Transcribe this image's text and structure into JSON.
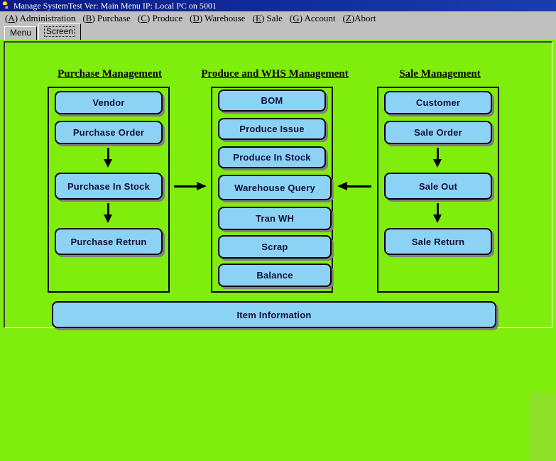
{
  "window": {
    "title": "Manage SystemTest Ver: Main Menu IP: Local PC on 5001",
    "icon": "app-icon"
  },
  "menubar": {
    "items": [
      {
        "accel": "A",
        "label": "Administration",
        "accel_prefix": "(A) ",
        "text": "(A) Administration"
      },
      {
        "accel": "B",
        "label": "Purchase",
        "text": "(B) Purchase"
      },
      {
        "accel": "C",
        "label": "Produce",
        "text": "(C) Produce"
      },
      {
        "accel": "D",
        "label": "Warehouse",
        "text": "(D) Warehouse"
      },
      {
        "accel": "E",
        "label": "Sale",
        "text": "(E) Sale"
      },
      {
        "accel": "G",
        "label": "Account",
        "text": "(G) Account"
      },
      {
        "accel": "Z",
        "label": "Abort",
        "text": "(Z)Abort"
      }
    ]
  },
  "tabs": [
    {
      "label": "Menu",
      "selected": false
    },
    {
      "label": "Screen",
      "selected": true
    }
  ],
  "columns": [
    {
      "title": "Purchase Management",
      "buttons": [
        "Vendor",
        "Purchase Order",
        "Purchase In Stock",
        "Purchase Retrun"
      ]
    },
    {
      "title": "Produce and WHS Management",
      "buttons": [
        "BOM",
        "Produce Issue",
        "Produce In Stock",
        "Warehouse Query",
        "Tran WH",
        "Scrap",
        "Balance"
      ]
    },
    {
      "title": "Sale Management",
      "buttons": [
        "Customer",
        "Sale Order",
        "Sale Out",
        "Sale Return"
      ]
    }
  ],
  "footer": {
    "button": "Item Information"
  },
  "colors": {
    "background_green": "#80ee0d",
    "corner_green": "#8ce028",
    "button_blue": "#8cd2f5",
    "titlebar_blue": "#0a1a86",
    "chrome_gray": "#c0c0c0",
    "outline_black": "#000000",
    "shadow_gray": "#808080"
  }
}
